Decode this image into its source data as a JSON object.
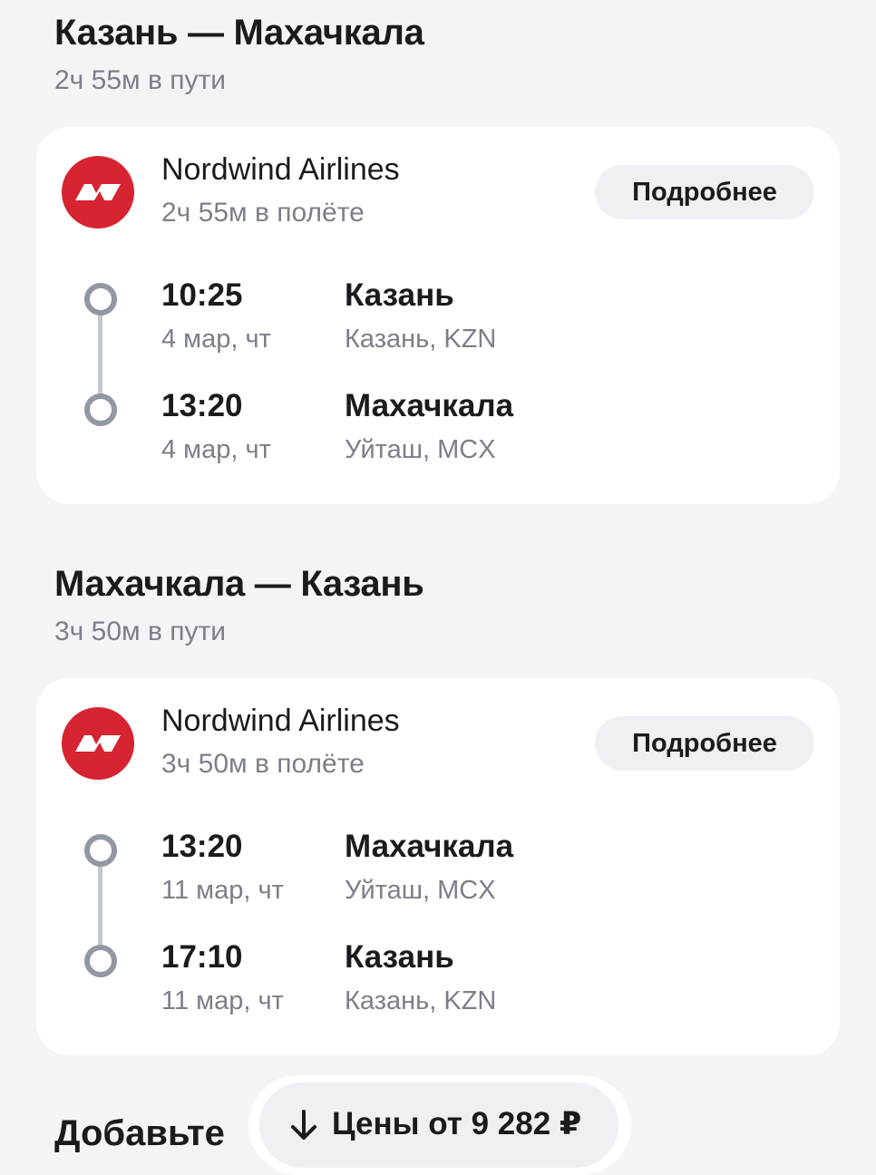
{
  "segments": [
    {
      "title": "Казань — Махачкала",
      "total_duration": "2ч 55м в пути",
      "airline": "Nordwind Airlines",
      "flight_duration": "2ч 55м в полёте",
      "details_label": "Подробнее",
      "departure": {
        "time": "10:25",
        "date": "4 мар, чт",
        "city": "Казань",
        "airport": "Казань, KZN"
      },
      "arrival": {
        "time": "13:20",
        "date": "4 мар, чт",
        "city": "Махачкала",
        "airport": "Уйташ, MCX"
      }
    },
    {
      "title": "Махачкала — Казань",
      "total_duration": "3ч 50м в пути",
      "airline": "Nordwind Airlines",
      "flight_duration": "3ч 50м в полёте",
      "details_label": "Подробнее",
      "departure": {
        "time": "13:20",
        "date": "11 мар, чт",
        "city": "Махачкала",
        "airport": "Уйташ, MCX"
      },
      "arrival": {
        "time": "17:10",
        "date": "11 мар, чт",
        "city": "Казань",
        "airport": "Казань, KZN"
      }
    }
  ],
  "add_section_title": "Добавьте",
  "price_button_label": "Цены от 9 282 ₽",
  "icons": {
    "airline_logo": "nordwind-logo-icon",
    "price_arrow": "arrow-down-icon"
  },
  "colors": {
    "airline_logo_bg": "#d62430",
    "background": "#f3f4f6",
    "muted_text": "#7b7f88"
  }
}
